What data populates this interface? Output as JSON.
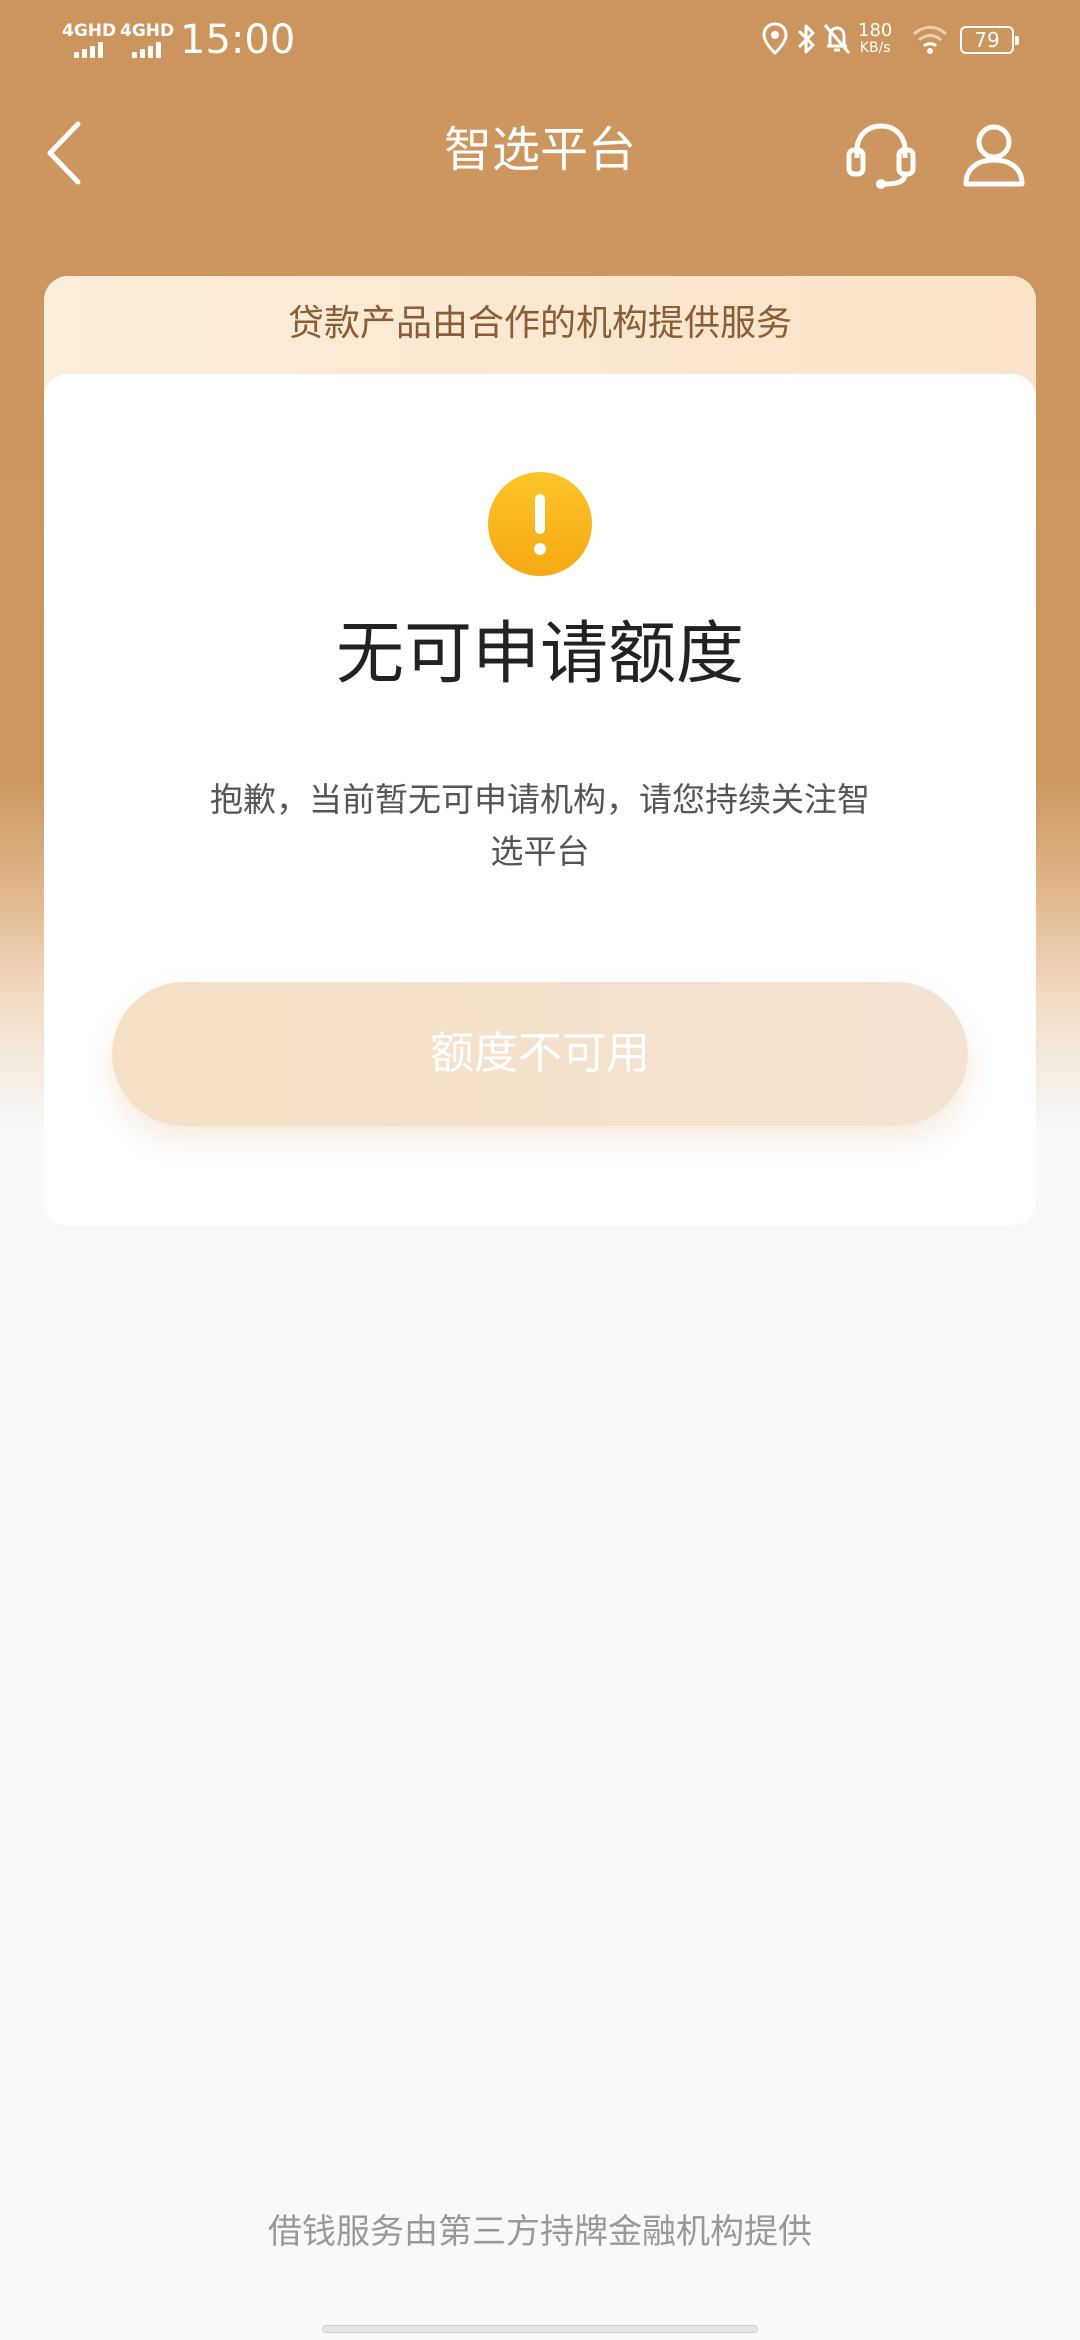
{
  "status_bar": {
    "network_1": "4GHD",
    "network_2": "4GHD",
    "time": "15:00",
    "speed_value": "180",
    "speed_unit": "KB/s",
    "battery": "79",
    "icons": [
      "location-icon",
      "bluetooth-icon",
      "mute-bell-icon",
      "wifi-icon"
    ]
  },
  "nav": {
    "title": "智选平台",
    "icons": [
      "back-arrow-icon",
      "customer-service-icon",
      "user-icon"
    ]
  },
  "card": {
    "banner": "贷款产品由合作的机构提供服务",
    "icon": "warning-icon",
    "heading": "无可申请额度",
    "description": "抱歉，当前暂无可申请机构，请您持续关注智选平台",
    "button_label": "额度不可用"
  },
  "footer": {
    "note": "借钱服务由第三方持牌金融机构提供"
  },
  "colors": {
    "header_brown": "#cc955e",
    "warning_yellow": "#fbb71e",
    "banner_text": "#8c5c35",
    "disabled_button": "#f5dfc6"
  }
}
